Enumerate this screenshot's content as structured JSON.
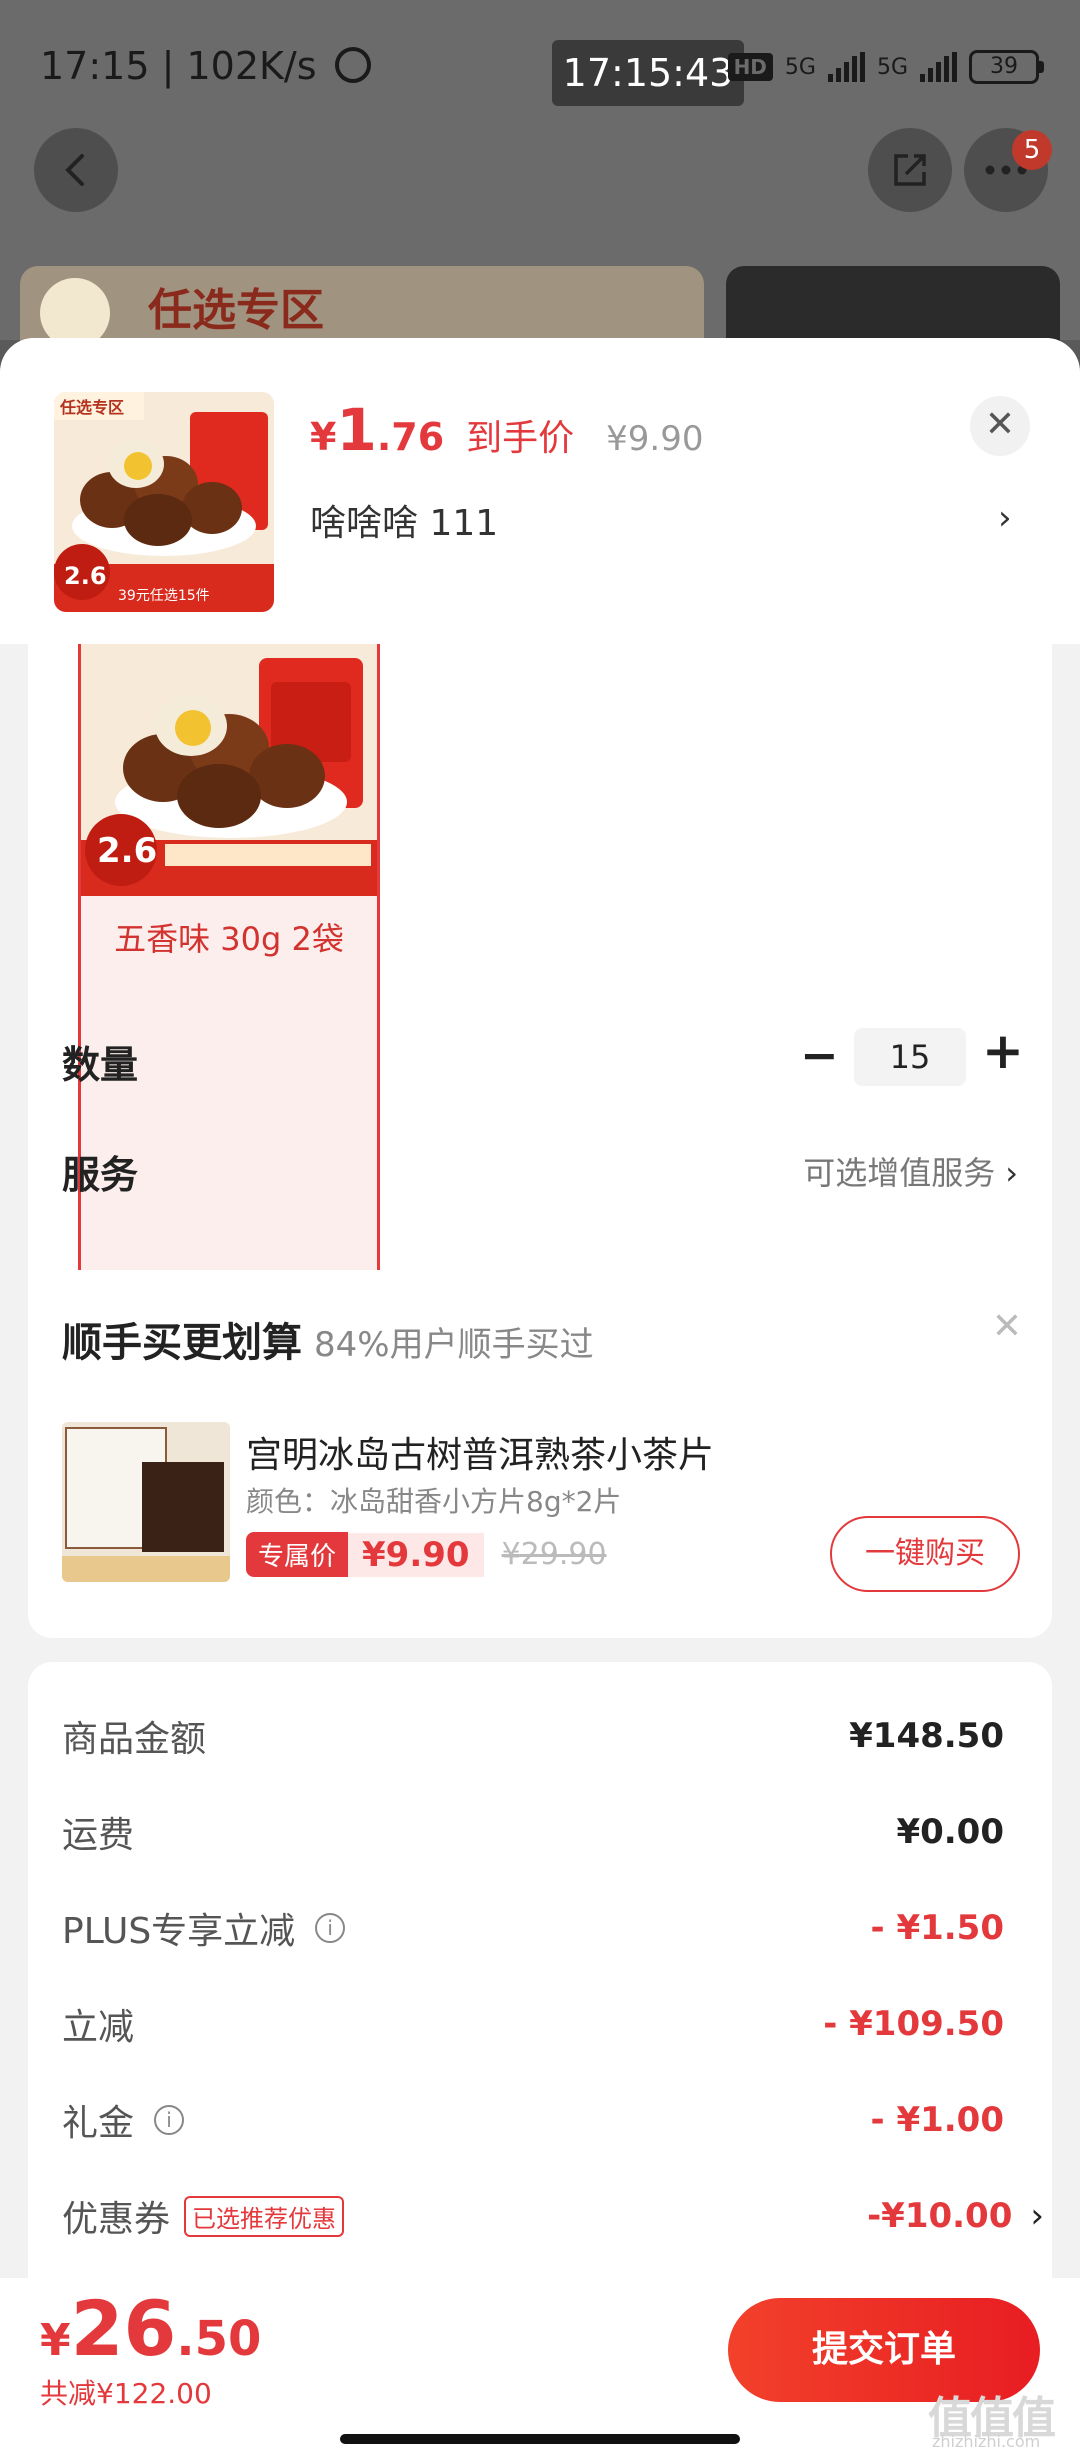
{
  "status_bar": {
    "left_text": "17:15 | 102K/s",
    "time": "17:15:43",
    "hd": "HD",
    "net1": "5G",
    "net2": "5G",
    "battery": "39"
  },
  "background": {
    "banner_text": "任选专区",
    "more_badge": "5"
  },
  "product": {
    "price_symbol": "¥",
    "price_int": "1",
    "price_dec": ".76",
    "price_tag": "到手价",
    "original_price": "¥9.90",
    "sku_text": "啥啥啥  111",
    "selected_variant": "五香味 30g 2袋",
    "thumb_badge": "任选专区",
    "thumb_price": "2.6",
    "thumb_promo": "39元任选15件"
  },
  "quantity": {
    "label": "数量",
    "value": "15",
    "minus": "−",
    "plus": "+"
  },
  "service": {
    "label": "服务",
    "value": "可选增值服务"
  },
  "addon": {
    "title": "顺手买更划算",
    "subtitle": "84%用户顺手买过",
    "name": "宫明冰岛古树普洱熟茶小茶片",
    "spec": "颜色：冰岛甜香小方片8g*2片",
    "exclusive_tag": "专属价",
    "price": "¥9.90",
    "original_price": "¥29.90",
    "buy_button": "一键购买"
  },
  "summary": {
    "goods_label": "商品金额",
    "goods_value": "¥148.50",
    "shipping_label": "运费",
    "shipping_value": "¥0.00",
    "plus_label": "PLUS专享立减",
    "plus_value": "- ¥1.50",
    "discount_label": "立减",
    "discount_value": "- ¥109.50",
    "gift_label": "礼金",
    "gift_value": "- ¥1.00",
    "coupon_label": "优惠券",
    "coupon_tag": "已选推荐优惠",
    "coupon_value": "-¥10.00"
  },
  "footer": {
    "total_symbol": "¥",
    "total_int": "26",
    "total_dec": ".50",
    "total_saved": "共减¥122.00",
    "submit": "提交订单"
  },
  "watermark": {
    "logo": "值值值",
    "site": "zhizhizhi.com"
  },
  "colors": {
    "accent": "#e4393c",
    "overlay": "#6b6b6b",
    "sheet_bg": "#f2f2f2"
  }
}
